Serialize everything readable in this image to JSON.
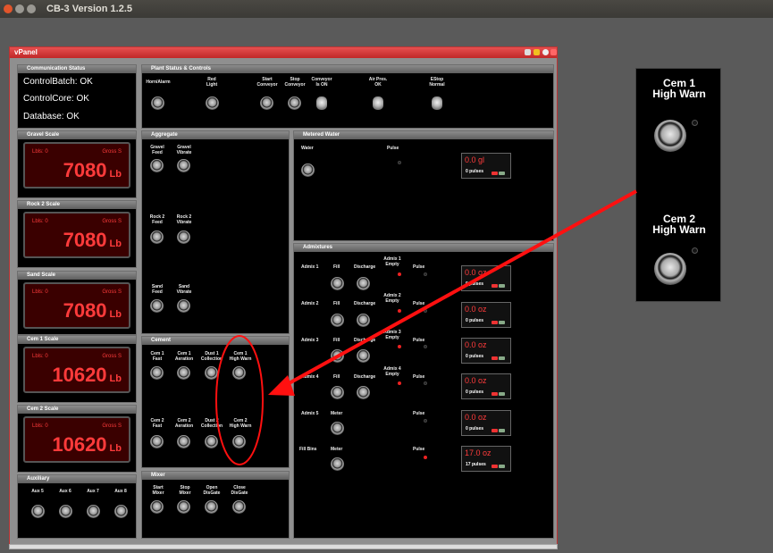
{
  "app": {
    "title": "CB-3 Version 1.2.5"
  },
  "window": {
    "title": "vPanel"
  },
  "comm": {
    "title": "Communication Status",
    "items": [
      "ControlBatch: OK",
      "ControlCore: OK",
      "Database: OK"
    ]
  },
  "plant": {
    "title": "Plant Status & Controls",
    "labels": {
      "horn": "Horn/Alarm",
      "red_light": "Red\nLight",
      "start_conveyor": "Start\nConveyor",
      "stop_conveyor": "Stop\nConveyor",
      "conveyor_on": "Conveyor\nIs ON",
      "air_pres": "Air Pres.\nOK",
      "estop": "EStop\nNormal"
    }
  },
  "scales": [
    {
      "title": "Gravel Scale",
      "lbls": "Lbls: 0",
      "gross": "Gross  S",
      "value": "7080",
      "unit": "Lb"
    },
    {
      "title": "Rock 2 Scale",
      "lbls": "Lbls: 0",
      "gross": "Gross  S",
      "value": "7080",
      "unit": "Lb"
    },
    {
      "title": "Sand Scale",
      "lbls": "Lbls: 0",
      "gross": "Gross  S",
      "value": "7080",
      "unit": "Lb"
    },
    {
      "title": "Cem 1 Scale",
      "lbls": "Lbls: 0",
      "gross": "Gross  S",
      "value": "10620",
      "unit": "Lb"
    },
    {
      "title": "Cem 2 Scale",
      "lbls": "Lbls: 0",
      "gross": "Gross  S",
      "value": "10620",
      "unit": "Lb"
    }
  ],
  "aux": {
    "title": "Auxiliary",
    "labels": [
      "Aux 5",
      "Aux 6",
      "Aux 7",
      "Aux 8"
    ]
  },
  "aggregate": {
    "title": "Aggregate",
    "labels": {
      "gravel_feed": "Gravel\nFeed",
      "gravel_vibrate": "Gravel\nVibrate",
      "rock2_feed": "Rock 2\nFeed",
      "rock2_vibrate": "Rock 2\nVibrate",
      "sand_feed": "Sand\nFeed",
      "sand_vibrate": "Sand\nVibrate"
    }
  },
  "cement": {
    "title": "Cement",
    "labels": {
      "cem1_fast": "Cem 1\nFast",
      "cem1_aeration": "Cem 1\nAeration",
      "dust1": "Dust 1\nCollection",
      "cem1_high": "Cem 1\nHigh Warn",
      "cem2_fast": "Cem 2\nFast",
      "cem2_aeration": "Cem 2\nAeration",
      "dust2": "Dust 2\nCollection",
      "cem2_high": "Cem 2\nHigh Warn"
    }
  },
  "mixer": {
    "title": "Mixer",
    "labels": {
      "start": "Start\nMixer",
      "stop": "Stop\nMixer",
      "open": "Open\nDisGate",
      "close": "Close\nDisGate"
    }
  },
  "water": {
    "title": "Metered Water",
    "water_label": "Water",
    "pulse_label": "Pulse",
    "amount": "0.0 gl",
    "pulses": "0 pulses"
  },
  "admix": {
    "title": "Admixtures",
    "fill": "Fill",
    "discharge": "Discharge",
    "meter": "Meter",
    "pulse": "Pulse",
    "rows": [
      {
        "name": "Admix 1",
        "empty": "Admix 1\nEmpty",
        "amount": "0.0 oz",
        "pulses": "0 pulses"
      },
      {
        "name": "Admix 2",
        "empty": "Admix 2\nEmpty",
        "amount": "0.0 oz",
        "pulses": "0 pulses"
      },
      {
        "name": "Admix 3",
        "empty": "Admix 3\nEmpty",
        "amount": "0.0 oz",
        "pulses": "0 pulses"
      },
      {
        "name": "Admix 4",
        "empty": "Admix 4\nEmpty",
        "amount": "0.0 oz",
        "pulses": "0 pulses"
      },
      {
        "name": "Admix 5",
        "amount": "0.0 oz",
        "pulses": "0 pulses"
      },
      {
        "name": "Fill Bins",
        "amount": "17.0 oz",
        "pulses": "17 pulses"
      }
    ]
  },
  "zoom": {
    "cem1": "Cem 1\nHigh Warn",
    "cem2": "Cem 2\nHigh Warn"
  },
  "colors": {
    "accent": "#d93030",
    "display_red": "#ff3b3b",
    "panel_bg": "#000000"
  }
}
